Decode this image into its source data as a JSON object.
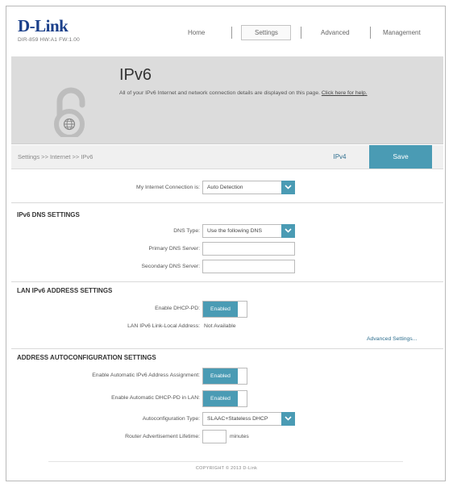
{
  "brand": {
    "logo": "D-Link",
    "model_info": "DIR-859 HW:A1 FW:1.00"
  },
  "nav": {
    "items": [
      "Home",
      "Settings",
      "Advanced",
      "Management"
    ],
    "active": "Settings"
  },
  "banner": {
    "title": "IPv6",
    "description": "All of your IPv6 Internet and network connection details are displayed on this page.",
    "help_link": "Click here for help."
  },
  "bar": {
    "breadcrumb": "Settings >> Internet >> IPv6",
    "ipv4_label": "IPv4",
    "save_label": "Save"
  },
  "connection": {
    "label": "My Internet Connection is:",
    "value": "Auto Detection"
  },
  "dns": {
    "heading": "IPv6 DNS SETTINGS",
    "type_label": "DNS Type:",
    "type_value": "Use the following DNS",
    "primary_label": "Primary DNS Server:",
    "primary_value": "",
    "secondary_label": "Secondary DNS Server:",
    "secondary_value": ""
  },
  "lan": {
    "heading": "LAN IPv6 ADDRESS SETTINGS",
    "pd_label": "Enable DHCP-PD:",
    "pd_value": "Enabled",
    "linklocal_label": "LAN IPv6 Link-Local Address:",
    "linklocal_value": "Not Available",
    "advanced_link": "Advanced Settings..."
  },
  "autoconf": {
    "heading": "ADDRESS AUTOCONFIGURATION SETTINGS",
    "auto_assign_label": "Enable Automatic IPv6 Address Assignment:",
    "auto_assign_value": "Enabled",
    "auto_pd_label": "Enable Automatic DHCP-PD in LAN:",
    "auto_pd_value": "Enabled",
    "type_label": "Autoconfiguration Type:",
    "type_value": "SLAAC+Stateless DHCP",
    "lifetime_label": "Router Advertisement Lifetime:",
    "lifetime_value": "",
    "lifetime_unit": "minutes"
  },
  "footer": {
    "copyright": "COPYRIGHT © 2013 D-Link"
  },
  "colors": {
    "accent": "#4a9bb4",
    "brand": "#1a3f8a",
    "banner": "#dcdcdc"
  },
  "icons": {
    "banner_icon": "ipv6-lock-globe-icon",
    "dropdown_icon": "chevron-down-icon"
  }
}
